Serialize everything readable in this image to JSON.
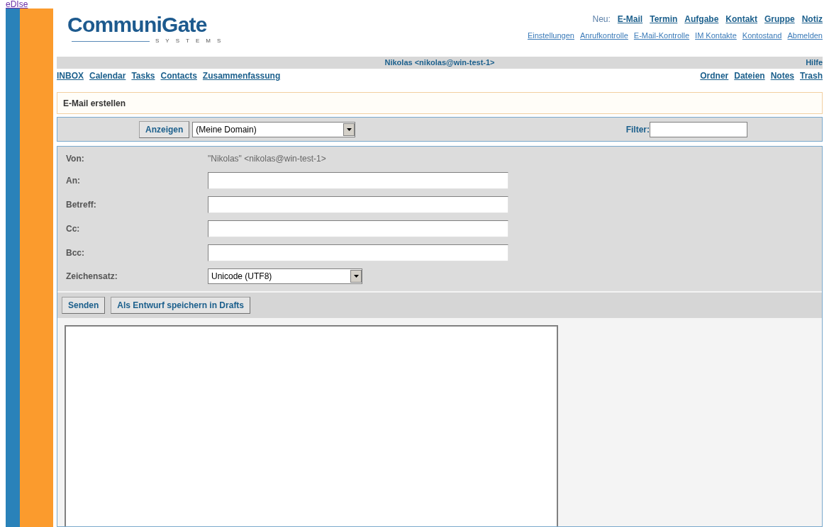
{
  "top_link": "eDIse",
  "logo": {
    "name": "CommuniGate",
    "tagline": "SYSTEMS"
  },
  "new_label": "Neu:",
  "new_links": [
    "E-Mail",
    "Termin",
    "Aufgabe",
    "Kontakt",
    "Gruppe",
    "Notiz"
  ],
  "account_links": [
    "Einstellungen",
    "Anrufkontrolle",
    "E-Mail-Kontrolle",
    "IM Kontakte",
    "Kontostand",
    "Abmelden"
  ],
  "user": "Nikolas <nikolas@win-test-1>",
  "help": "Hilfe",
  "nav_left": [
    "INBOX",
    "Calendar",
    "Tasks",
    "Contacts",
    "Zusammenfassung"
  ],
  "nav_right": [
    "Ordner",
    "Dateien",
    "Notes",
    "Trash"
  ],
  "page_title": "E-Mail erstellen",
  "toolbar": {
    "button": "Anzeigen",
    "domain": "(Meine Domain)",
    "filter_label": "Filter:"
  },
  "form": [
    {
      "kind": "text",
      "label": "Von:",
      "value": "\"Nikolas\" <nikolas@win-test-1>"
    },
    {
      "kind": "input",
      "label": "An:"
    },
    {
      "kind": "input",
      "label": "Betreff:"
    },
    {
      "kind": "input",
      "label": "Cc:"
    },
    {
      "kind": "input",
      "label": "Bcc:"
    },
    {
      "kind": "select",
      "label": "Zeichensatz:",
      "value": "Unicode (UTF8)"
    }
  ],
  "actions": [
    "Senden",
    "Als Entwurf speichern in Drafts"
  ]
}
